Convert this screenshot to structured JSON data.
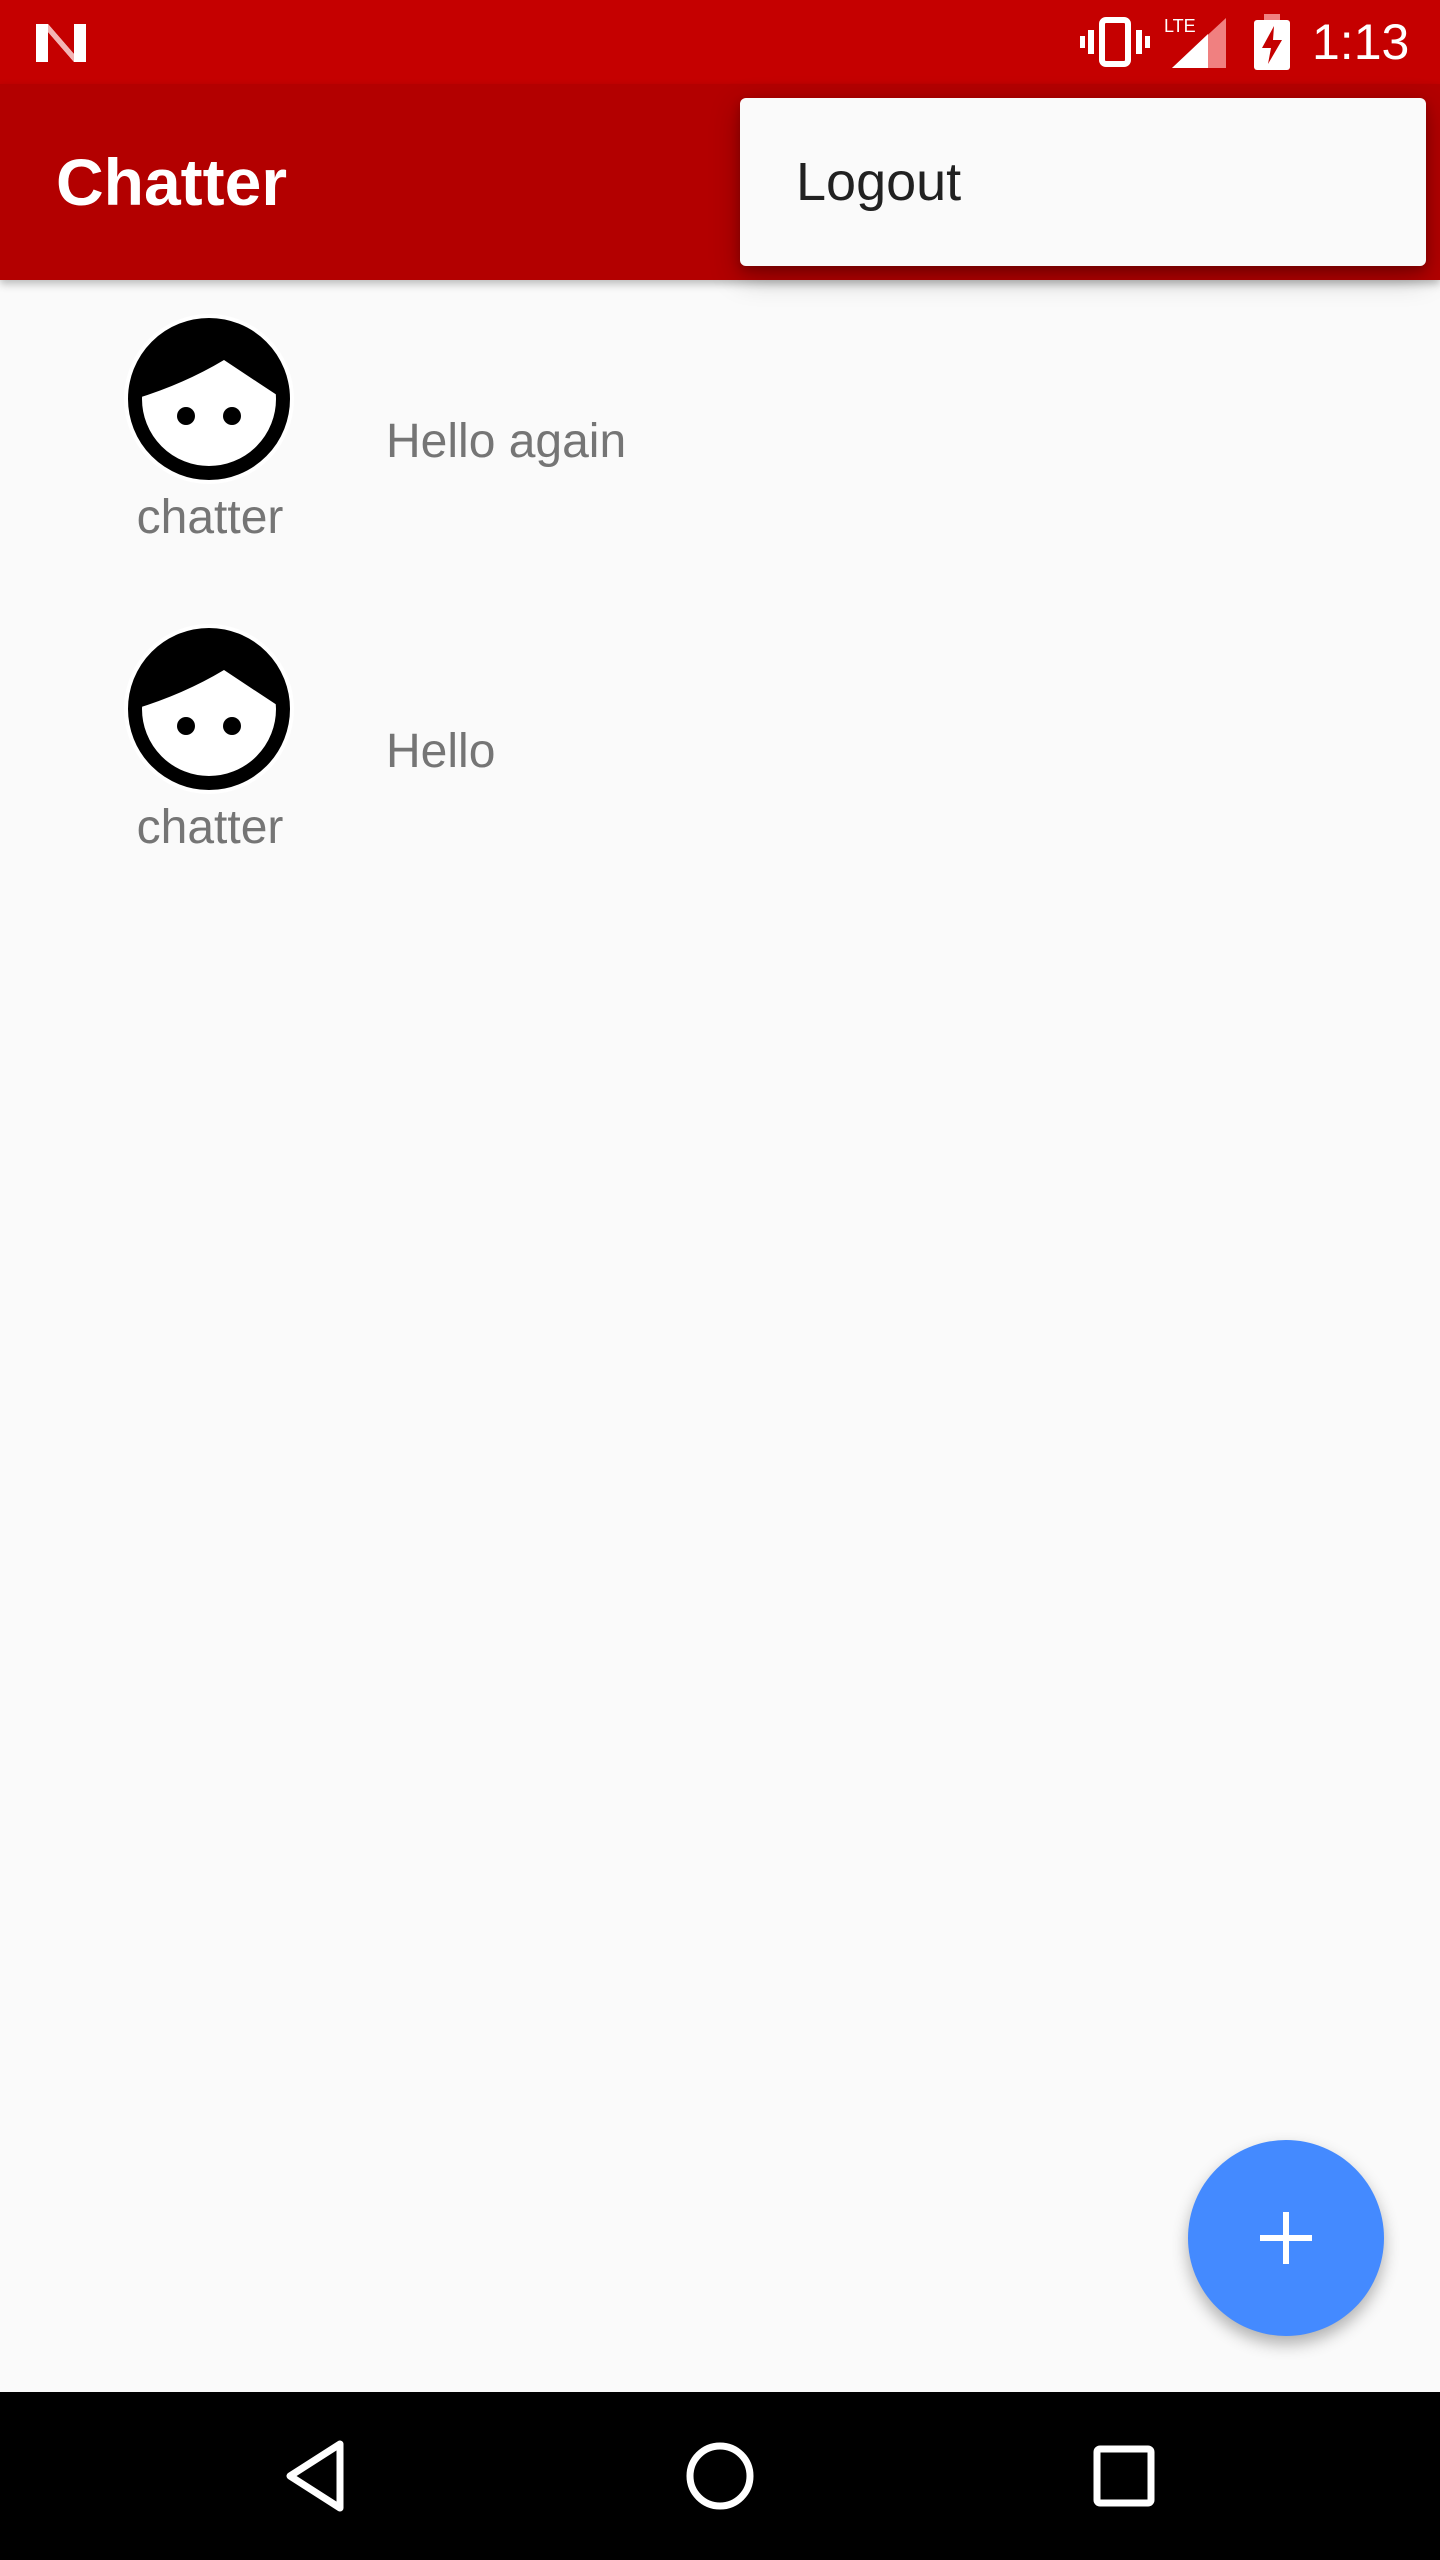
{
  "status_bar": {
    "time": "1:13",
    "icons": [
      "notification-n-icon",
      "vibrate-icon",
      "lte-signal-icon",
      "battery-charging-icon"
    ]
  },
  "app_bar": {
    "title": "Chatter"
  },
  "overflow_menu": {
    "items": [
      {
        "label": "Logout"
      }
    ]
  },
  "messages": [
    {
      "author": "chatter",
      "text": "Hello again",
      "avatar_icon": "face-icon"
    },
    {
      "author": "chatter",
      "text": "Hello",
      "avatar_icon": "face-icon"
    }
  ],
  "fab": {
    "icon": "plus-icon"
  },
  "nav_bar": {
    "buttons": [
      "back-icon",
      "home-icon",
      "recents-icon"
    ]
  },
  "colors": {
    "status_bar": "#c50000",
    "app_bar": "#b30000",
    "fab": "#448aff",
    "background": "#fafafa"
  }
}
